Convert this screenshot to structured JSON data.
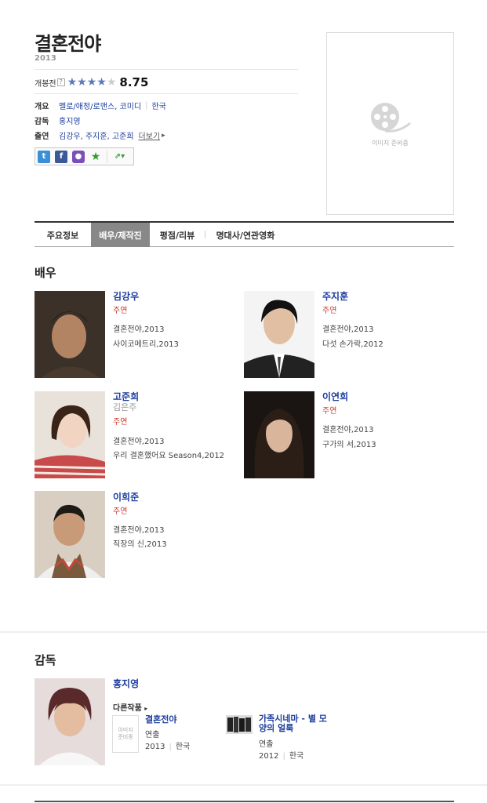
{
  "movie": {
    "title": "결혼전야",
    "year": "2013",
    "rating_label": "개봉전",
    "help_mark": "?",
    "score": "8.75",
    "stars": 4.5,
    "info": [
      {
        "key": "개요",
        "values": [
          "멜로/애정/로맨스, 코미디",
          "한국"
        ]
      },
      {
        "key": "감독",
        "values": [
          "홍지영"
        ]
      },
      {
        "key": "출연",
        "values": [
          "김강우, 주지훈, 고준희"
        ],
        "more": "더보기"
      }
    ],
    "poster_caption": "이미지 준비중"
  },
  "share": {
    "icons": [
      "twitter-icon",
      "facebook-icon",
      "me2day-icon",
      "star-icon",
      "share-icon"
    ]
  },
  "tabs": [
    {
      "label": "주요정보"
    },
    {
      "label": "배우/제작진",
      "active": true
    },
    {
      "label": "평점/리뷰"
    },
    {
      "label": "명대사/연관영화"
    }
  ],
  "actors_title": "배우",
  "actors": [
    {
      "name": "김강우",
      "role": "주연",
      "works": [
        "결혼전야,2013",
        "사이코메트리,2013"
      ]
    },
    {
      "name": "주지훈",
      "role": "주연",
      "works": [
        "결혼전야,2013",
        "다섯 손가락,2012"
      ]
    },
    {
      "name": "고준희",
      "sub": "김은주",
      "role": "주연",
      "works": [
        "결혼전야,2013",
        "우리 결혼했어요 Season4,2012"
      ]
    },
    {
      "name": "이연희",
      "role": "주연",
      "works": [
        "결혼전야,2013",
        "구가의 서,2013"
      ]
    },
    {
      "name": "이희준",
      "role": "주연",
      "works": [
        "결혼전야,2013",
        "직장의 신,2013"
      ]
    }
  ],
  "director_title": "감독",
  "director": {
    "name": "홍지영",
    "other_label": "다른작품",
    "works": [
      {
        "title": "결혼전야",
        "role": "연출",
        "year": "2013",
        "country": "한국",
        "noimg": "이미지\n준비중"
      },
      {
        "title": "가족시네마 - 별 모양의 얼룩",
        "role": "연출",
        "year": "2012",
        "country": "한국"
      }
    ]
  },
  "colors": {
    "link": "#1b3c9e",
    "role": "#c8382e",
    "tab_active": "#888888"
  }
}
